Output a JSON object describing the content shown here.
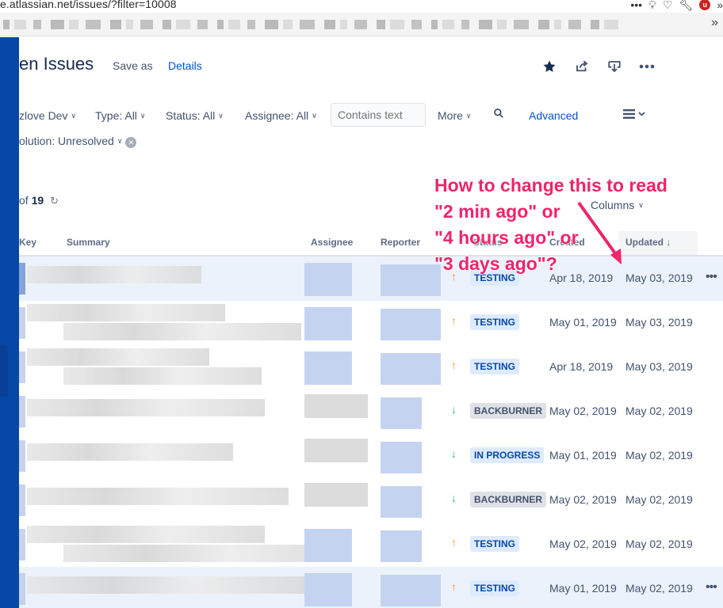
{
  "browser": {
    "url": "e.atlassian.net/issues/?filter=10008"
  },
  "header": {
    "title": "en Issues",
    "save_as": "Save as",
    "details": "Details"
  },
  "filters": {
    "project": "zlove Dev",
    "type": "Type: All",
    "status": "Status: All",
    "assignee": "Assignee: All",
    "text_placeholder": "Contains text",
    "more": "More",
    "advanced": "Advanced",
    "resolution": "olution: Unresolved"
  },
  "results": {
    "count_prefix": "of",
    "count": "19",
    "columns_label": "Columns"
  },
  "table": {
    "headers": {
      "key": "Key",
      "summary": "Summary",
      "assignee": "Assignee",
      "reporter": "Reporter",
      "status": "Status",
      "created": "Created",
      "updated": "Updated"
    },
    "rows": [
      {
        "priority": "up",
        "status": "TESTING",
        "created": "Apr 18, 2019",
        "updated": "May 03, 2019"
      },
      {
        "priority": "up",
        "status": "TESTING",
        "created": "May 01, 2019",
        "updated": "May 03, 2019"
      },
      {
        "priority": "up",
        "status": "TESTING",
        "created": "Apr 18, 2019",
        "updated": "May 03, 2019"
      },
      {
        "priority": "down",
        "status": "BACKBURNER",
        "created": "May 02, 2019",
        "updated": "May 02, 2019"
      },
      {
        "priority": "down",
        "status": "IN PROGRESS",
        "created": "May 01, 2019",
        "updated": "May 02, 2019"
      },
      {
        "priority": "down",
        "status": "BACKBURNER",
        "created": "May 02, 2019",
        "updated": "May 02, 2019"
      },
      {
        "priority": "up",
        "status": "TESTING",
        "created": "May 02, 2019",
        "updated": "May 02, 2019"
      },
      {
        "priority": "up",
        "status": "TESTING",
        "created": "May 01, 2019",
        "updated": "May 02, 2019"
      }
    ]
  },
  "annotation": {
    "line1": "How to change this to read",
    "line2": "\"2 min ago\" or",
    "line3": "\"4 hours ago\" or",
    "line4": "\"3 days ago\"?",
    "color": "#f0246a"
  },
  "icons": {
    "star": "star-icon",
    "share": "share-icon",
    "export": "export-icon",
    "more": "more-icon",
    "search": "search-icon",
    "view": "list-view-icon",
    "refresh": "refresh-icon"
  }
}
